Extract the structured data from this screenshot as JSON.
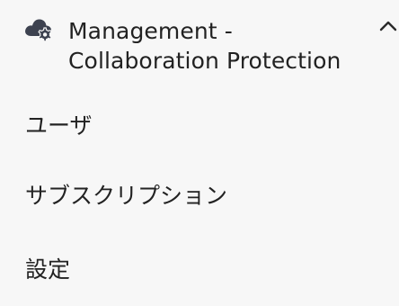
{
  "section": {
    "icon": "cloud-gear-icon",
    "title": "Management - Collaboration Protection",
    "expanded_icon": "chevron-up-icon"
  },
  "items": [
    {
      "label": "ユーザ"
    },
    {
      "label": "サブスクリプション"
    },
    {
      "label": "設定"
    }
  ],
  "colors": {
    "background": "#f7f7f7",
    "text": "#222222",
    "icon": "#3d4250"
  }
}
